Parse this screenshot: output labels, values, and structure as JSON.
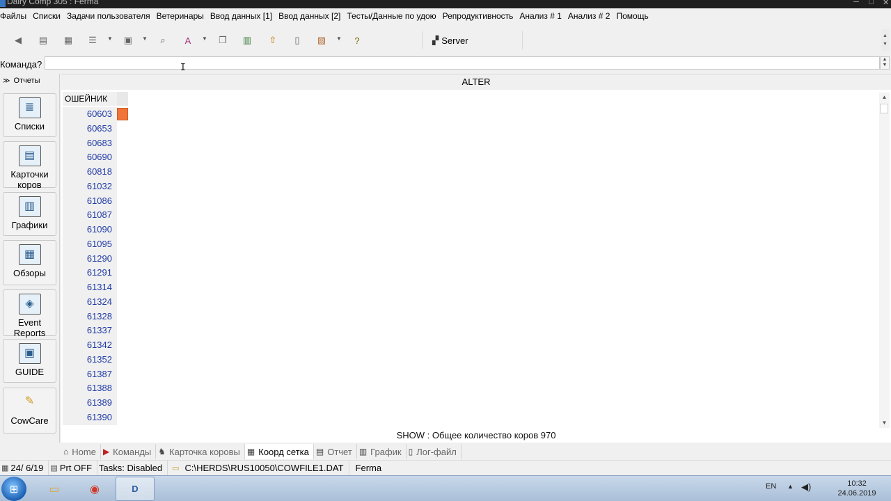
{
  "window": {
    "title": "Dairy Comp 305 : Ferma"
  },
  "menu": [
    "Файлы",
    "Списки",
    "Задачи пользователя",
    "Ветеринары",
    "Ввод данных [1]",
    "Ввод данных [2]",
    "Тесты/Данные по удою",
    "Репродуктивность",
    "Анализ # 1",
    "Анализ # 2",
    "Помощь"
  ],
  "toolbar": {
    "server_label": "Server"
  },
  "command": {
    "label": "Команда?",
    "value": ""
  },
  "left_panel": {
    "header": "Отчеты",
    "items": [
      {
        "label": "Списки",
        "icon": "list-icon"
      },
      {
        "label": "Карточки коров",
        "icon": "cow-card-icon"
      },
      {
        "label": "Графики",
        "icon": "chart-icon"
      },
      {
        "label": "Обзоры",
        "icon": "overview-icon"
      },
      {
        "label": "Event Reports",
        "icon": "event-reports-icon"
      },
      {
        "label": "GUIDE",
        "icon": "guide-icon"
      },
      {
        "label": "CowCare",
        "icon": "cowcare-icon"
      }
    ]
  },
  "grid": {
    "title": "ALTER",
    "column_header": "ОШЕЙНИК",
    "rows": [
      "60603",
      "60653",
      "60683",
      "60690",
      "60818",
      "61032",
      "61086",
      "61087",
      "61090",
      "61095",
      "61290",
      "61291",
      "61314",
      "61324",
      "61328",
      "61337",
      "61342",
      "61352",
      "61387",
      "61388",
      "61389",
      "61390"
    ],
    "marker_color": "#f0753a",
    "status": "SHOW : Общее количество коров  970"
  },
  "tabs": [
    {
      "label": "Home",
      "icon": "home-icon",
      "active": false
    },
    {
      "label": "Команды",
      "icon": "commands-icon",
      "active": false
    },
    {
      "label": "Карточка коровы",
      "icon": "cow-icon",
      "active": false
    },
    {
      "label": "Коорд сетка",
      "icon": "grid-icon",
      "active": true
    },
    {
      "label": "Отчет",
      "icon": "report-icon",
      "active": false
    },
    {
      "label": "График",
      "icon": "chart-icon",
      "active": false
    },
    {
      "label": "Лог-файл",
      "icon": "log-icon",
      "active": false
    }
  ],
  "statusbar": {
    "date": "24/ 6/19",
    "print": "Prt OFF",
    "tasks": "Tasks: Disabled",
    "path": "C:\\HERDS\\RUS10050\\COWFILE1.DAT",
    "farm": "Ferma"
  },
  "taskbar": {
    "lang": "EN",
    "time": "10:32",
    "date": "24.06.2019"
  }
}
